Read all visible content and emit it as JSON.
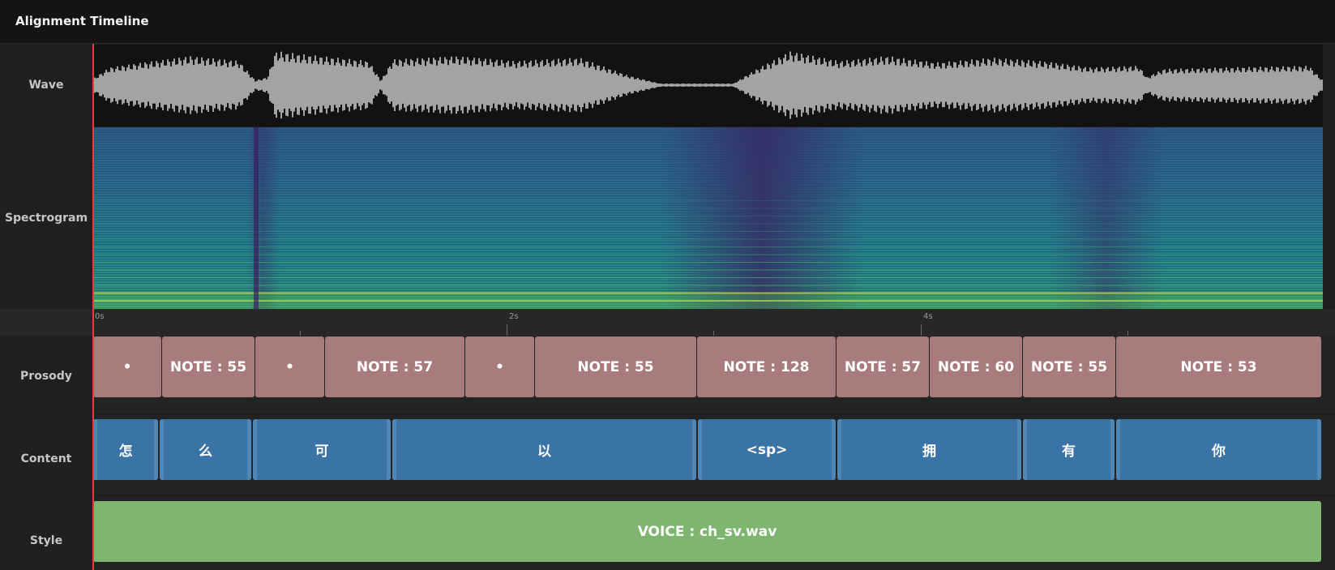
{
  "window": {
    "title": "Alignment Timeline"
  },
  "tracks": {
    "wave": "Wave",
    "spectrogram": "Spectrogram",
    "prosody": "Prosody",
    "content": "Content",
    "style": "Style"
  },
  "ruler": {
    "labels": [
      "0s",
      "2s",
      "4s"
    ]
  },
  "prosody": [
    "•",
    "NOTE : 55",
    "•",
    "NOTE : 57",
    "•",
    "NOTE : 55",
    "NOTE : 128",
    "NOTE : 57",
    "NOTE : 60",
    "NOTE : 55",
    "NOTE : 53"
  ],
  "content": [
    "怎",
    "么",
    "可",
    "以",
    "<sp>",
    "拥",
    "有",
    "你"
  ],
  "style": {
    "label": "VOICE : ch_sv.wav"
  },
  "colors": {
    "playhead": "#e0413c",
    "prosody": "#a87c7c",
    "content": "#3a73a6",
    "style": "#7eb66f"
  }
}
